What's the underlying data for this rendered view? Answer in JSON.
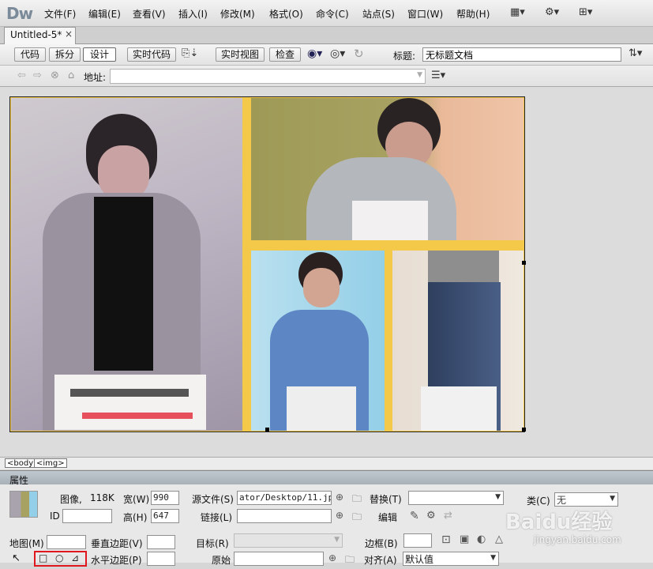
{
  "app": {
    "logo": "Dw",
    "menus": [
      "文件(F)",
      "编辑(E)",
      "查看(V)",
      "插入(I)",
      "修改(M)",
      "格式(O)",
      "命令(C)",
      "站点(S)",
      "窗口(W)",
      "帮助(H)"
    ],
    "icons": [
      "layout-icon",
      "gear-icon",
      "site-icon"
    ]
  },
  "document_tab": {
    "name": "Untitled-5*",
    "close": "×"
  },
  "toolbar": {
    "code_label": "代码",
    "split_label": "拆分",
    "design_label": "设计",
    "live_code_label": "实时代码",
    "live_view_label": "实时视图",
    "inspect_label": "检查",
    "title_label": "标题:",
    "title_value": "无标题文档"
  },
  "addressbar": {
    "label": "地址:",
    "value": ""
  },
  "statusbar": {
    "tags": [
      "<body>",
      "<img>"
    ]
  },
  "properties": {
    "panel_title": "属性",
    "type_label": "图像,",
    "size": "118K",
    "width_label": "宽(W)",
    "width_value": "990",
    "height_label": "高(H)",
    "height_value": "647",
    "src_label": "源文件(S)",
    "src_value": "ator/Desktop/11.jpg",
    "alt_label": "替换(T)",
    "alt_value": "",
    "class_label": "类(C)",
    "class_value": "无",
    "id_label": "ID",
    "id_value": "",
    "link_label": "链接(L)",
    "link_value": "",
    "edit_label": "编辑",
    "map_label": "地图(M)",
    "map_value": "",
    "vspace_label": "垂直边距(V)",
    "vspace_value": "",
    "target_label": "目标(R)",
    "border_label": "边框(B)",
    "border_value": "",
    "hspace_label": "水平边距(P)",
    "hspace_value": "",
    "original_label": "原始",
    "align_label": "对齐(A)",
    "align_value": "默认值"
  },
  "watermark": {
    "brand": "Baidu经验",
    "url": "jingyan.baidu.com"
  }
}
